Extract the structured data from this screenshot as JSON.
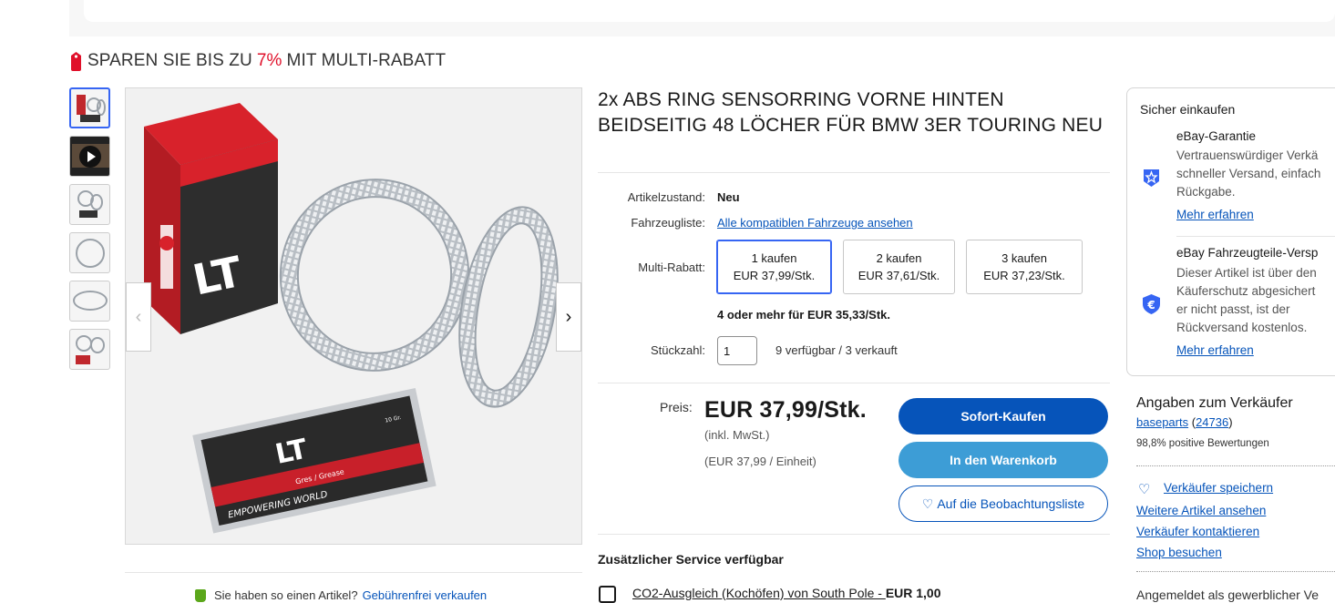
{
  "promo": {
    "prefix": "SPAREN SIE BIS ZU",
    "percent": "7%",
    "suffix": "MIT MULTI-RABATT",
    "accent_color": "#e0102a"
  },
  "gallery": {
    "thumbnails": [
      "product-thumb",
      "video-thumb",
      "ring-thumb",
      "ring-thumb",
      "ring-thumb",
      "kit-thumb"
    ],
    "prev_icon": "‹",
    "next_icon": "›",
    "packaging_text": {
      "brand": "LT",
      "grease_label": "Gres / Grease",
      "grease_weight": "10 Gr.",
      "slogan": "EMPOWERING WORLD"
    }
  },
  "sell_note": {
    "text": "Sie haben so einen Artikel?",
    "link": "Gebührenfrei verkaufen"
  },
  "product": {
    "title": "2x ABS RING SENSORRING VORNE HINTEN BEIDSEITIG 48 LÖCHER FÜR BMW 3ER TOURING NEU",
    "condition_label": "Artikelzustand:",
    "condition_value": "Neu",
    "fitment_label": "Fahrzeugliste:",
    "fitment_link": "Alle kompatiblen Fahrzeuge ansehen",
    "multi_label": "Multi-Rabatt:",
    "multi_options": [
      {
        "qty": "1 kaufen",
        "price": "EUR 37,99/Stk."
      },
      {
        "qty": "2 kaufen",
        "price": "EUR 37,61/Stk."
      },
      {
        "qty": "3 kaufen",
        "price": "EUR 37,23/Stk."
      }
    ],
    "multi_more": "4 oder mehr für EUR 35,33/Stk.",
    "quantity_label": "Stückzahl:",
    "quantity_value": "1",
    "availability": "9 verfügbar / 3 verkauft",
    "price_label": "Preis:",
    "price": "EUR 37,99/Stk.",
    "vat_note": "(inkl. MwSt.)",
    "unit_price": "(EUR 37,99 / Einheit)"
  },
  "actions": {
    "buy_now": "Sofort-Kaufen",
    "add_to_cart": "In den Warenkorb",
    "watchlist": "Auf die Beobachtungsliste",
    "watch_icon": "heart-icon"
  },
  "services": {
    "title": "Zusätzlicher Service verfügbar",
    "co2_label": "CO2-Ausgleich (Kochöfen) von South Pole - ",
    "co2_price": "EUR 1,00"
  },
  "secure": {
    "title": "Sicher einkaufen",
    "guarantee_title": "eBay-Garantie",
    "guarantee_lines": [
      "Vertrauenswürdiger Verkä",
      "schneller Versand, einfach",
      "Rückgabe."
    ],
    "guarantee_link": "Mehr erfahren",
    "parts_title": "eBay Fahrzeugteile-Versp",
    "parts_lines": [
      "Dieser Artikel ist über den",
      "Käuferschutz abgesichert",
      "er nicht passt, ist der",
      "Rückversand kostenlos."
    ],
    "parts_link": "Mehr erfahren"
  },
  "seller": {
    "title": "Angaben zum Verkäufer",
    "name": "baseparts",
    "feedback_count": "24736",
    "positive": "98,8% positive Bewertungen",
    "save_seller": "Verkäufer speichern",
    "more_items": "Weitere Artikel ansehen",
    "contact": "Verkäufer kontaktieren",
    "shop": "Shop besuchen",
    "footer": "Angemeldet als gewerblicher Ve"
  },
  "colors": {
    "primary_blue": "#0654ba",
    "cart_blue": "#3d9dd6",
    "selected_border": "#3665f3"
  }
}
